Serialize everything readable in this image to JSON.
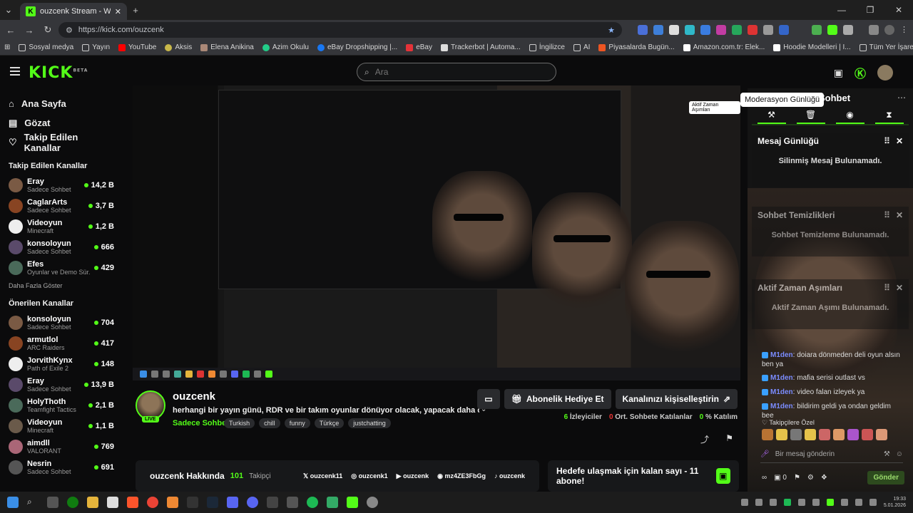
{
  "browser": {
    "tab_title": "ouzcenk Stream - Watch Live o",
    "url": "https://kick.com/ouzcenk",
    "bookmarks": [
      "Sosyal medya",
      "Yayın",
      "YouTube",
      "Aksis",
      "Elena Anikina",
      "Azim Okulu",
      "eBay Dropshipping |...",
      "eBay",
      "Trackerbot | Automa...",
      "İngilizce",
      "AI",
      "Piyasalarda Bugün...",
      "Amazon.com.tr: Elek...",
      "Hoodie Modelleri | I..."
    ],
    "bookmarks_all": "Tüm Yer İşaretleri"
  },
  "header": {
    "logo": "KICK",
    "logo_sup": "BETA",
    "search_placeholder": "Ara"
  },
  "sidebar": {
    "nav": [
      {
        "label": "Ana Sayfa",
        "icon": "home-icon"
      },
      {
        "label": "Gözat",
        "icon": "browse-icon"
      },
      {
        "label": "Takip Edilen Kanallar",
        "icon": "heart-icon"
      }
    ],
    "followed_title": "Takip Edilen Kanallar",
    "followed": [
      {
        "name": "Eray",
        "category": "Sadece Sohbet",
        "viewers": "14,2 B"
      },
      {
        "name": "CaglarArts",
        "category": "Sadece Sohbet",
        "viewers": "3,7 B"
      },
      {
        "name": "Videoyun",
        "category": "Minecraft",
        "viewers": "1,2 B"
      },
      {
        "name": "konsoloyun",
        "category": "Sadece Sohbet",
        "viewers": "666"
      },
      {
        "name": "Efes",
        "category": "Oyunlar ve Demo Sür...",
        "viewers": "429"
      }
    ],
    "show_more": "Daha Fazla Göster",
    "recommended_title": "Önerilen Kanallar",
    "recommended": [
      {
        "name": "konsoloyun",
        "category": "Sadece Sohbet",
        "viewers": "704"
      },
      {
        "name": "armutlol",
        "category": "ARC Raiders",
        "viewers": "417"
      },
      {
        "name": "JorvithKynx",
        "category": "Path of Exile 2",
        "viewers": "148"
      },
      {
        "name": "Eray",
        "category": "Sadece Sohbet",
        "viewers": "13,9 B"
      },
      {
        "name": "HolyThoth",
        "category": "Teamfight Tactics",
        "viewers": "2,1 B"
      },
      {
        "name": "Videoyun",
        "category": "Minecraft",
        "viewers": "1,1 B"
      },
      {
        "name": "aimdll",
        "category": "VALORANT",
        "viewers": "769"
      },
      {
        "name": "Nesrin",
        "category": "Sadece Sohbet",
        "viewers": "691"
      }
    ]
  },
  "player": {
    "tooltip": "Aktif Zaman Aşımları"
  },
  "stream": {
    "name": "ouzcenk",
    "live": "LIVE",
    "title": "herhangi bir yayın günü, RDR ve bir takım oyunlar dönüyor olacak, yapacak daha önemli bir i...",
    "category": "Sadece Sohbet",
    "tags": [
      "Turkish",
      "chill",
      "funny",
      "Türkçe",
      "justchatting"
    ],
    "gift_button": "Abonelik Hediye Et",
    "customize_button": "Kanalınızı kişiselleştirin",
    "viewers": "6",
    "viewers_label": "İzleyiciler",
    "avg_chatters": "0",
    "avg_chatters_label": "Ort. Sohbete Katılanlar",
    "participation": "0",
    "participation_label": "% Katılım"
  },
  "about": {
    "title": "ouzcenk Hakkında",
    "followers": "101",
    "followers_label": "Takipçi",
    "socials": [
      "ouzcenk11",
      "ouzcenk1",
      "ouzcenk",
      "mz4ZE3FbGg",
      "ouzcenk"
    ]
  },
  "goal": {
    "text": "Hedefe ulaşmak için kalan sayı - 11 abone!"
  },
  "chat": {
    "title": "Sohbet",
    "mod_tooltip": "Moderasyon Günlüğü",
    "message_log_title": "Mesaj Günlüğü",
    "message_log_empty": "Silinmiş Mesaj Bulunamadı.",
    "clears_title": "Sohbet Temizlikleri",
    "clears_empty": "Sohbet Temizleme Bulunamadı.",
    "timeouts_title": "Aktif Zaman Aşımları",
    "timeouts_empty": "Aktif Zaman Aşımı Bulunamadı.",
    "messages": [
      {
        "user": "M1den",
        "text": "doiara dönmeden deli oyun alsın ben ya"
      },
      {
        "user": "M1den",
        "text": "mafia serisi outlast vs"
      },
      {
        "user": "M1den",
        "text": "video falan izleyek ya"
      },
      {
        "user": "M1den",
        "text": "bildirim geldi ya ondan geldim bee"
      }
    ],
    "subs_only": "Takipçilere Özel",
    "input_placeholder": "Bir mesaj gönderin",
    "points": "0",
    "send_button": "Gönder"
  },
  "taskbar": {
    "time": "19:33",
    "date": "5.01.2026"
  }
}
